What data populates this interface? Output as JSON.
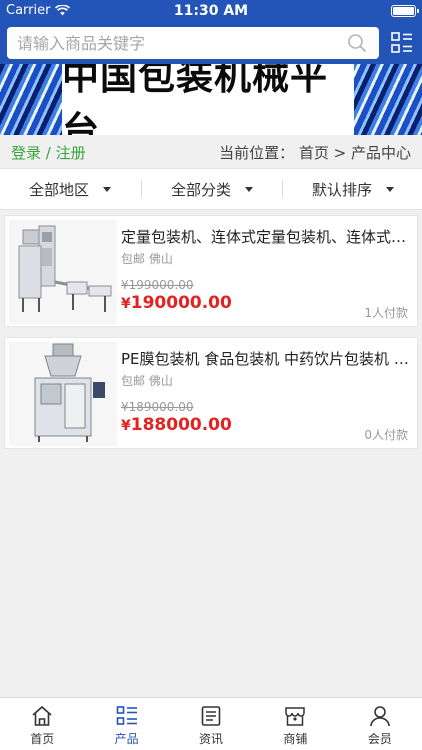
{
  "status": {
    "carrier": "Carrier",
    "time": "11:30 AM"
  },
  "search": {
    "placeholder": "请输入商品关键字"
  },
  "banner": {
    "title": "中国包装机械平台"
  },
  "auth": {
    "login": "登录",
    "sep": " / ",
    "register": "注册"
  },
  "breadcrumb": {
    "text": "当前位置： 首页 > 产品中心"
  },
  "filters": [
    "全部地区",
    "全部分类",
    "默认排序"
  ],
  "products": [
    {
      "name": "定量包装机、连体式定量包装机、连体式定量包装机",
      "tags": "包邮 佛山",
      "old_price": "¥199000.00",
      "currency": "¥",
      "price": "190000.00",
      "sold": "1人付款"
    },
    {
      "name": "PE膜包装机 食品包装机 中药饮片包装机 颗粒包装机",
      "tags": "包邮 佛山",
      "old_price": "¥189000.00",
      "currency": "¥",
      "price": "188000.00",
      "sold": "0人付款"
    }
  ],
  "tabs": [
    {
      "label": "首页",
      "icon": "home-icon",
      "active": false
    },
    {
      "label": "产品",
      "icon": "list-icon",
      "active": true
    },
    {
      "label": "资讯",
      "icon": "news-icon",
      "active": false
    },
    {
      "label": "商铺",
      "icon": "shop-icon",
      "active": false
    },
    {
      "label": "会员",
      "icon": "user-icon",
      "active": false
    }
  ],
  "colors": {
    "primary": "#2255b7",
    "price": "#e32222",
    "auth": "#3aa43a"
  }
}
